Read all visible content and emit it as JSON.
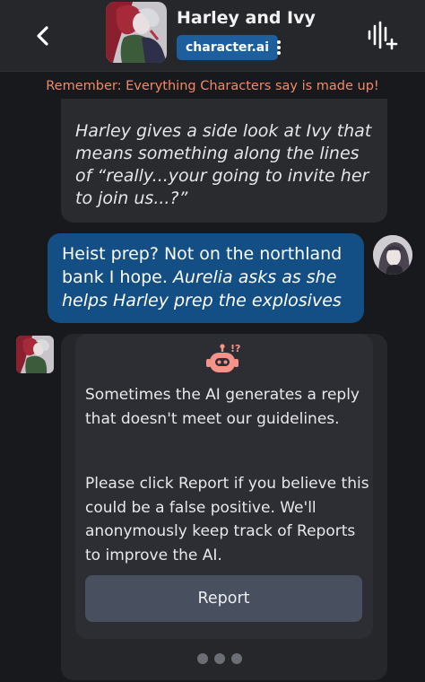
{
  "header": {
    "character_name": "Harley and Ivy",
    "brand_badge": "character.ai"
  },
  "disclaimer": "Remember: Everything Characters say is made up!",
  "messages": {
    "bot_top": "Harley gives a side look at Ivy that means something along the lines of “really...your going to invite her to join us...?”",
    "user_plain": "Heist prep? Not on the northland bank I hope.",
    "user_italic": "Aurelia asks as she helps Harley prep the explosives"
  },
  "moderation": {
    "icon": "robot-alert-icon",
    "line1": "Sometimes the AI generates a reply that doesn't meet our guidelines.",
    "line2": "Please click Report if you believe this could be a false positive. We'll anonymously keep track of Reports to improve the AI.",
    "report_label": "Report"
  },
  "colors": {
    "background": "#18191c",
    "header": "#26272b",
    "brand_badge": "#1c5e9e",
    "user_bubble": "#134e85",
    "disclaimer_text": "#f08a66",
    "robot_icon": "#f4938a",
    "report_button": "#48505f"
  }
}
